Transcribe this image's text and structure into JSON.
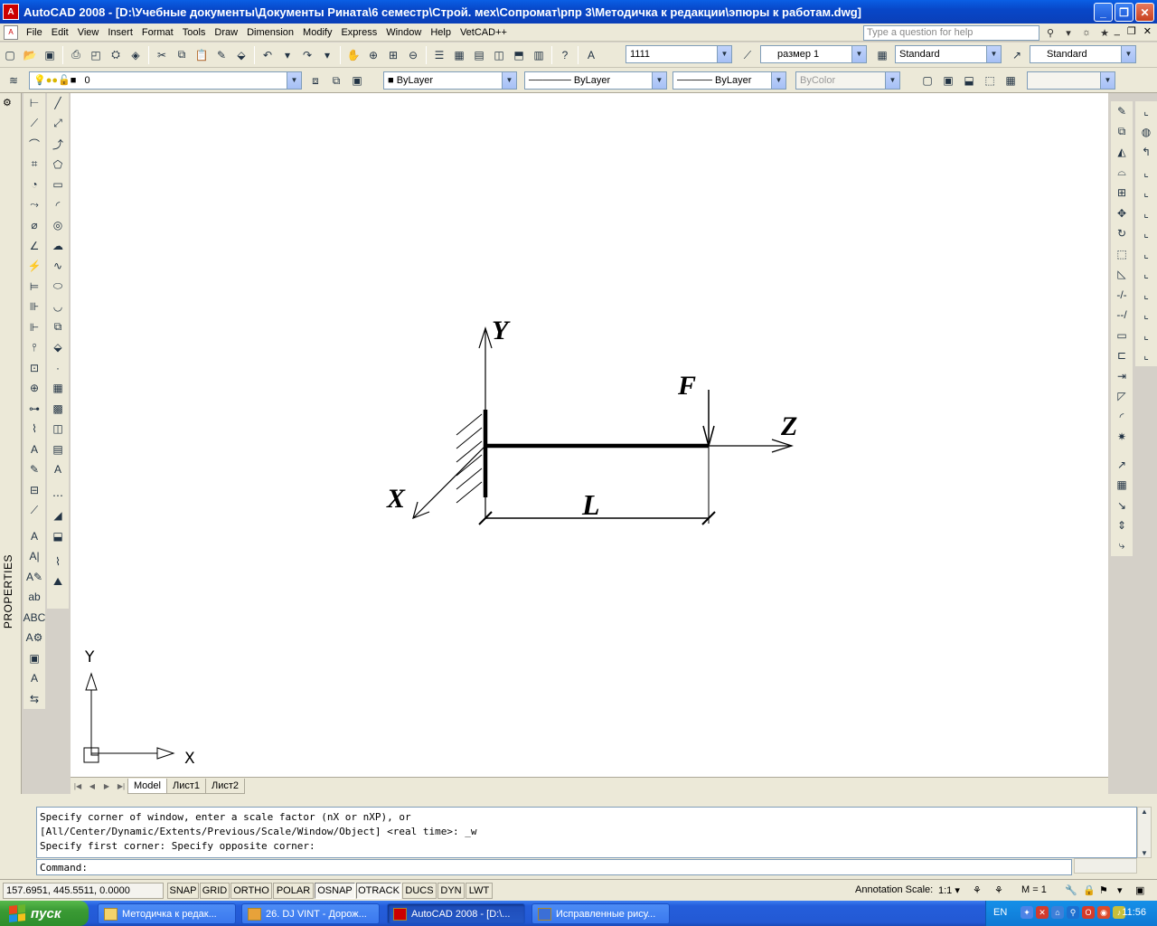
{
  "window": {
    "title": "AutoCAD 2008 - [D:\\Учебные документы\\Документы Рината\\6 семестр\\Строй. мех\\Сопромат\\рпр 3\\Методичка к редакции\\эпюры к работам.dwg]",
    "app_icon_text": "A"
  },
  "menu": {
    "items": [
      "File",
      "Edit",
      "View",
      "Insert",
      "Format",
      "Tools",
      "Draw",
      "Dimension",
      "Modify",
      "Express",
      "Window",
      "Help",
      "VetCAD++"
    ],
    "help_placeholder": "Type a question for help"
  },
  "toolbar1": {
    "text_style_value": "1111",
    "dim_style_value": "размер 1",
    "table_style_value": "Standard",
    "multileader_style_value": "Standard"
  },
  "toolbar2": {
    "layer_value": "0",
    "color_value": "ByLayer",
    "linetype_value": "ByLayer",
    "lineweight_value": "ByLayer",
    "plotstyle_value": "ByColor"
  },
  "properties_label": "PROPERTIES",
  "drawing": {
    "labels": {
      "y_axis": "Y",
      "x_axis": "X",
      "z_axis": "Z",
      "force": "F",
      "length": "L"
    },
    "ucs": {
      "x_label": "X",
      "y_label": "Y"
    }
  },
  "layout_tabs": [
    "Model",
    "Лист1",
    "Лист2"
  ],
  "command": {
    "history": [
      "Specify corner of window, enter a scale factor (nX or nXP), or",
      "[All/Center/Dynamic/Extents/Previous/Scale/Window/Object] <real time>: _w",
      "Specify first corner: Specify opposite corner:"
    ],
    "prompt": "Command:"
  },
  "status": {
    "coordinates": "157.6951, 445.5511, 0.0000",
    "buttons": [
      "SNAP",
      "GRID",
      "ORTHO",
      "POLAR",
      "OSNAP",
      "OTRACK",
      "DUCS",
      "DYN",
      "LWT"
    ],
    "active_buttons": [
      "OSNAP",
      "OTRACK"
    ],
    "annotation_scale_label": "Annotation Scale:",
    "annotation_scale_value": "1:1",
    "multiplier": "M = 1"
  },
  "taskbar": {
    "start_label": "пуск",
    "tasks": [
      "Методичка к редак...",
      "26. DJ VINT - Дорож...",
      "AutoCAD 2008 - [D:\\...",
      "Исправленные рису..."
    ],
    "active_task": 2,
    "language": "EN",
    "clock": "11:56"
  },
  "colors": {
    "titlebar": "#0a5fe5",
    "chrome": "#ece9d8",
    "taskbar": "#245edb",
    "start_button": "#3a9a34"
  }
}
